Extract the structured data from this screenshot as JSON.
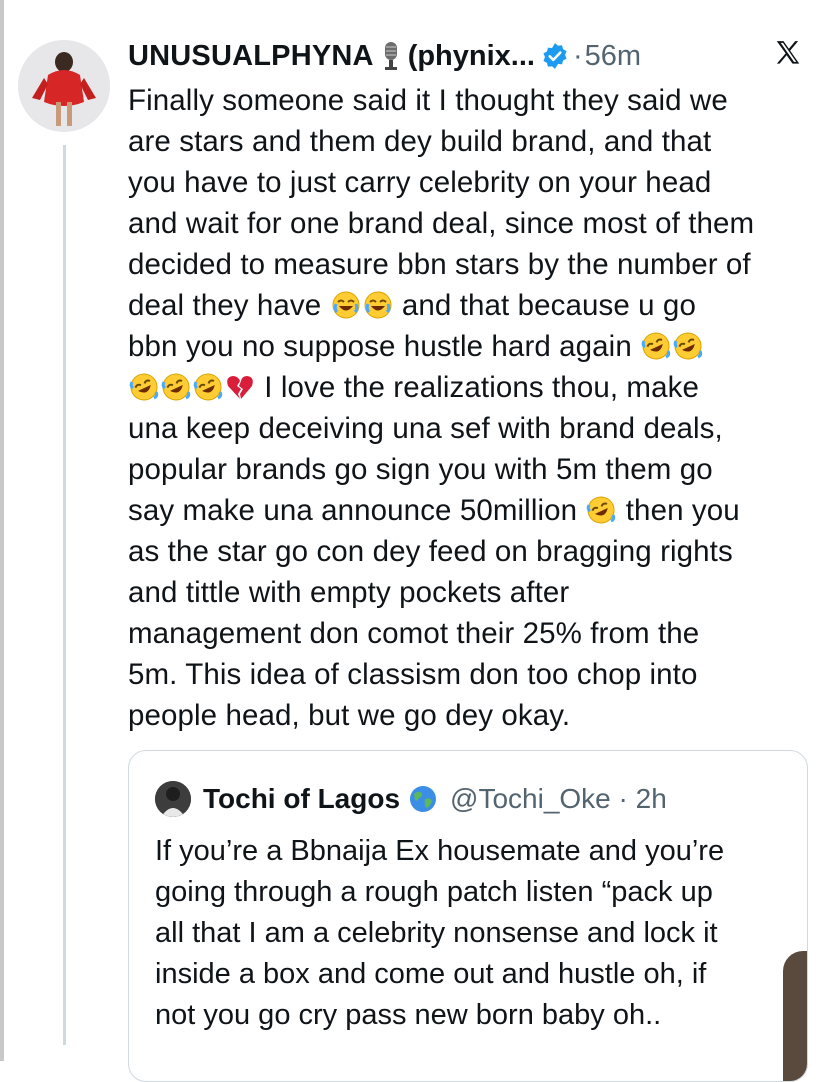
{
  "tweet": {
    "display_name": "UNUSUALPHYNA",
    "handle_fragment": "(phynix...",
    "dot": "·",
    "time": "56m",
    "lines": {
      "l1": "Finally someone said it I thought they said we\nare stars and them dey build brand, and that\nyou have to just carry celebrity on your head\nand wait for one brand deal, since most of them\ndecided to measure bbn stars by the number of\ndeal they have ",
      "l2": " and that because u go\nbbn you no suppose hustle hard again ",
      "l3": " I love the realizations thou, make\nuna keep deceiving una sef with brand deals,\npopular brands go sign you with 5m them go\nsay make una announce 50million ",
      "l4": " then you\nas the star go con dey feed on bragging rights\nand tittle with empty pockets after\nmanagement don comot their  25% from the\n5m. This idea of classism don too chop into\npeople head, but we go dey okay."
    }
  },
  "quoted": {
    "name": "Tochi of Lagos",
    "handle": "@Tochi_Oke · 2h",
    "text": "If you’re a Bbnaija Ex housemate and you’re\ngoing through a rough patch listen “pack up\nall that I am a celebrity nonsense and lock it\ninside a box and come out and hustle oh, if\nnot you go cry pass new born baby oh.."
  },
  "icons": [
    "microphone-icon",
    "verified-icon",
    "x-logo-icon",
    "joy-emoji",
    "rofl-emoji",
    "broken-heart-emoji",
    "globe-icon"
  ],
  "colors": {
    "verified": "#1d9bf0",
    "muted": "#536471",
    "border": "#cfd9de"
  }
}
